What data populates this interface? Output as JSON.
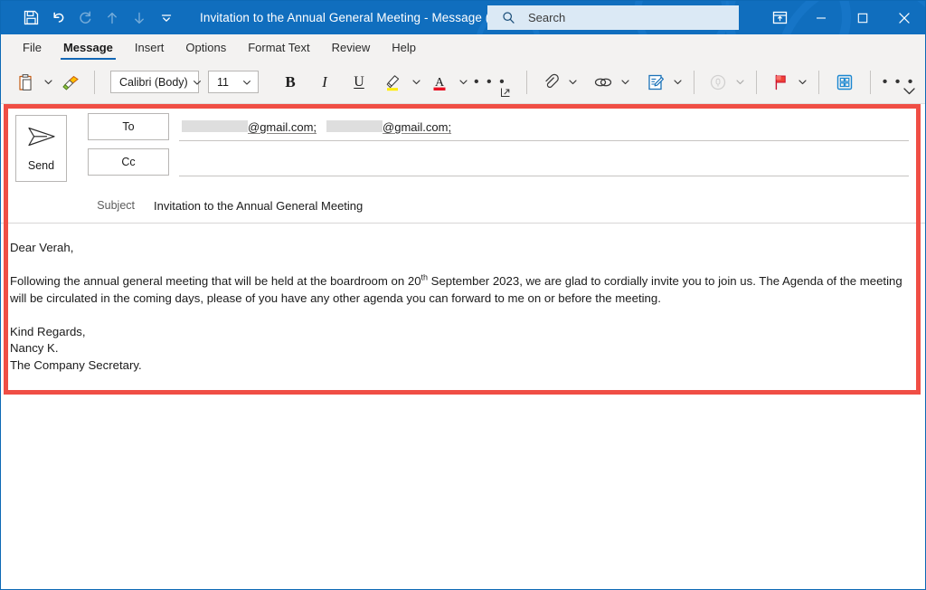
{
  "window": {
    "title": "Invitation to the Annual General Meeting  -  Message (HT...",
    "accent_color": "#106ebe",
    "annotation_color": "#f04e45"
  },
  "quick_access": [
    {
      "name": "save-icon",
      "label": "Save",
      "enabled": true
    },
    {
      "name": "undo-icon",
      "label": "Undo",
      "enabled": true
    },
    {
      "name": "redo-icon",
      "label": "Redo",
      "enabled": false
    },
    {
      "name": "move-up-icon",
      "label": "Move Up",
      "enabled": false
    },
    {
      "name": "move-down-icon",
      "label": "Move Down",
      "enabled": false
    },
    {
      "name": "customize-quick-access-icon",
      "label": "Customize Quick Access Toolbar",
      "enabled": true
    }
  ],
  "search": {
    "placeholder": "Search",
    "value": "",
    "icon": "search-icon"
  },
  "window_controls": [
    {
      "name": "ribbon-display-options-icon",
      "label": "Ribbon Display Options"
    },
    {
      "name": "minimize-icon",
      "label": "Minimize"
    },
    {
      "name": "maximize-icon",
      "label": "Maximize"
    },
    {
      "name": "close-icon",
      "label": "Close"
    }
  ],
  "ribbon_tabs": [
    {
      "label": "File",
      "active": false
    },
    {
      "label": "Message",
      "active": true
    },
    {
      "label": "Insert",
      "active": false
    },
    {
      "label": "Options",
      "active": false
    },
    {
      "label": "Format Text",
      "active": false
    },
    {
      "label": "Review",
      "active": false
    },
    {
      "label": "Help",
      "active": false
    }
  ],
  "ribbon": {
    "paste_label": "Paste",
    "format_painter_label": "Format Painter",
    "font_name": "Calibri (Body)",
    "font_size": "11",
    "bold_label": "B",
    "italic_label": "I",
    "underline_label": "U",
    "highlight_label": "Text Highlight Color",
    "highlight_color": "#ffed00",
    "font_color_label": "Font Color",
    "font_color": "#e81123",
    "more_formatting_label": "• • •",
    "attach_label": "Attach File",
    "link_label": "Link",
    "signature_label": "Signature",
    "dictate_label": "Dictate",
    "dictate_enabled": false,
    "follow_up_label": "Follow Up",
    "apps_label": "Apps",
    "more_commands_label": "• • •",
    "dialog_launcher_label": "Font Settings",
    "expand_ribbon_label": "Expand the Ribbon"
  },
  "compose": {
    "send_label": "Send",
    "to_label": "To",
    "cc_label": "Cc",
    "subject_label": "Subject",
    "subject_value": "Invitation to the Annual General Meeting",
    "to_recipients": [
      {
        "redacted": true,
        "visible_text": "@gmail.com;"
      },
      {
        "redacted": true,
        "visible_text": "@gmail.com;"
      }
    ],
    "cc_value": ""
  },
  "message_body": {
    "greeting": "Dear Verah,",
    "paragraph_part1": "Following the annual general meeting that will be held at the boardroom on 20",
    "ordinal_suffix": "th",
    "paragraph_part2": " September 2023, we are glad to cordially invite you to join us. The Agenda of the meeting will be circulated in the coming days, please of you have any other agenda you can forward to me on or before the meeting.",
    "signoff": "Kind Regards,",
    "sender_name": "Nancy K.",
    "sender_title": "The Company Secretary."
  }
}
